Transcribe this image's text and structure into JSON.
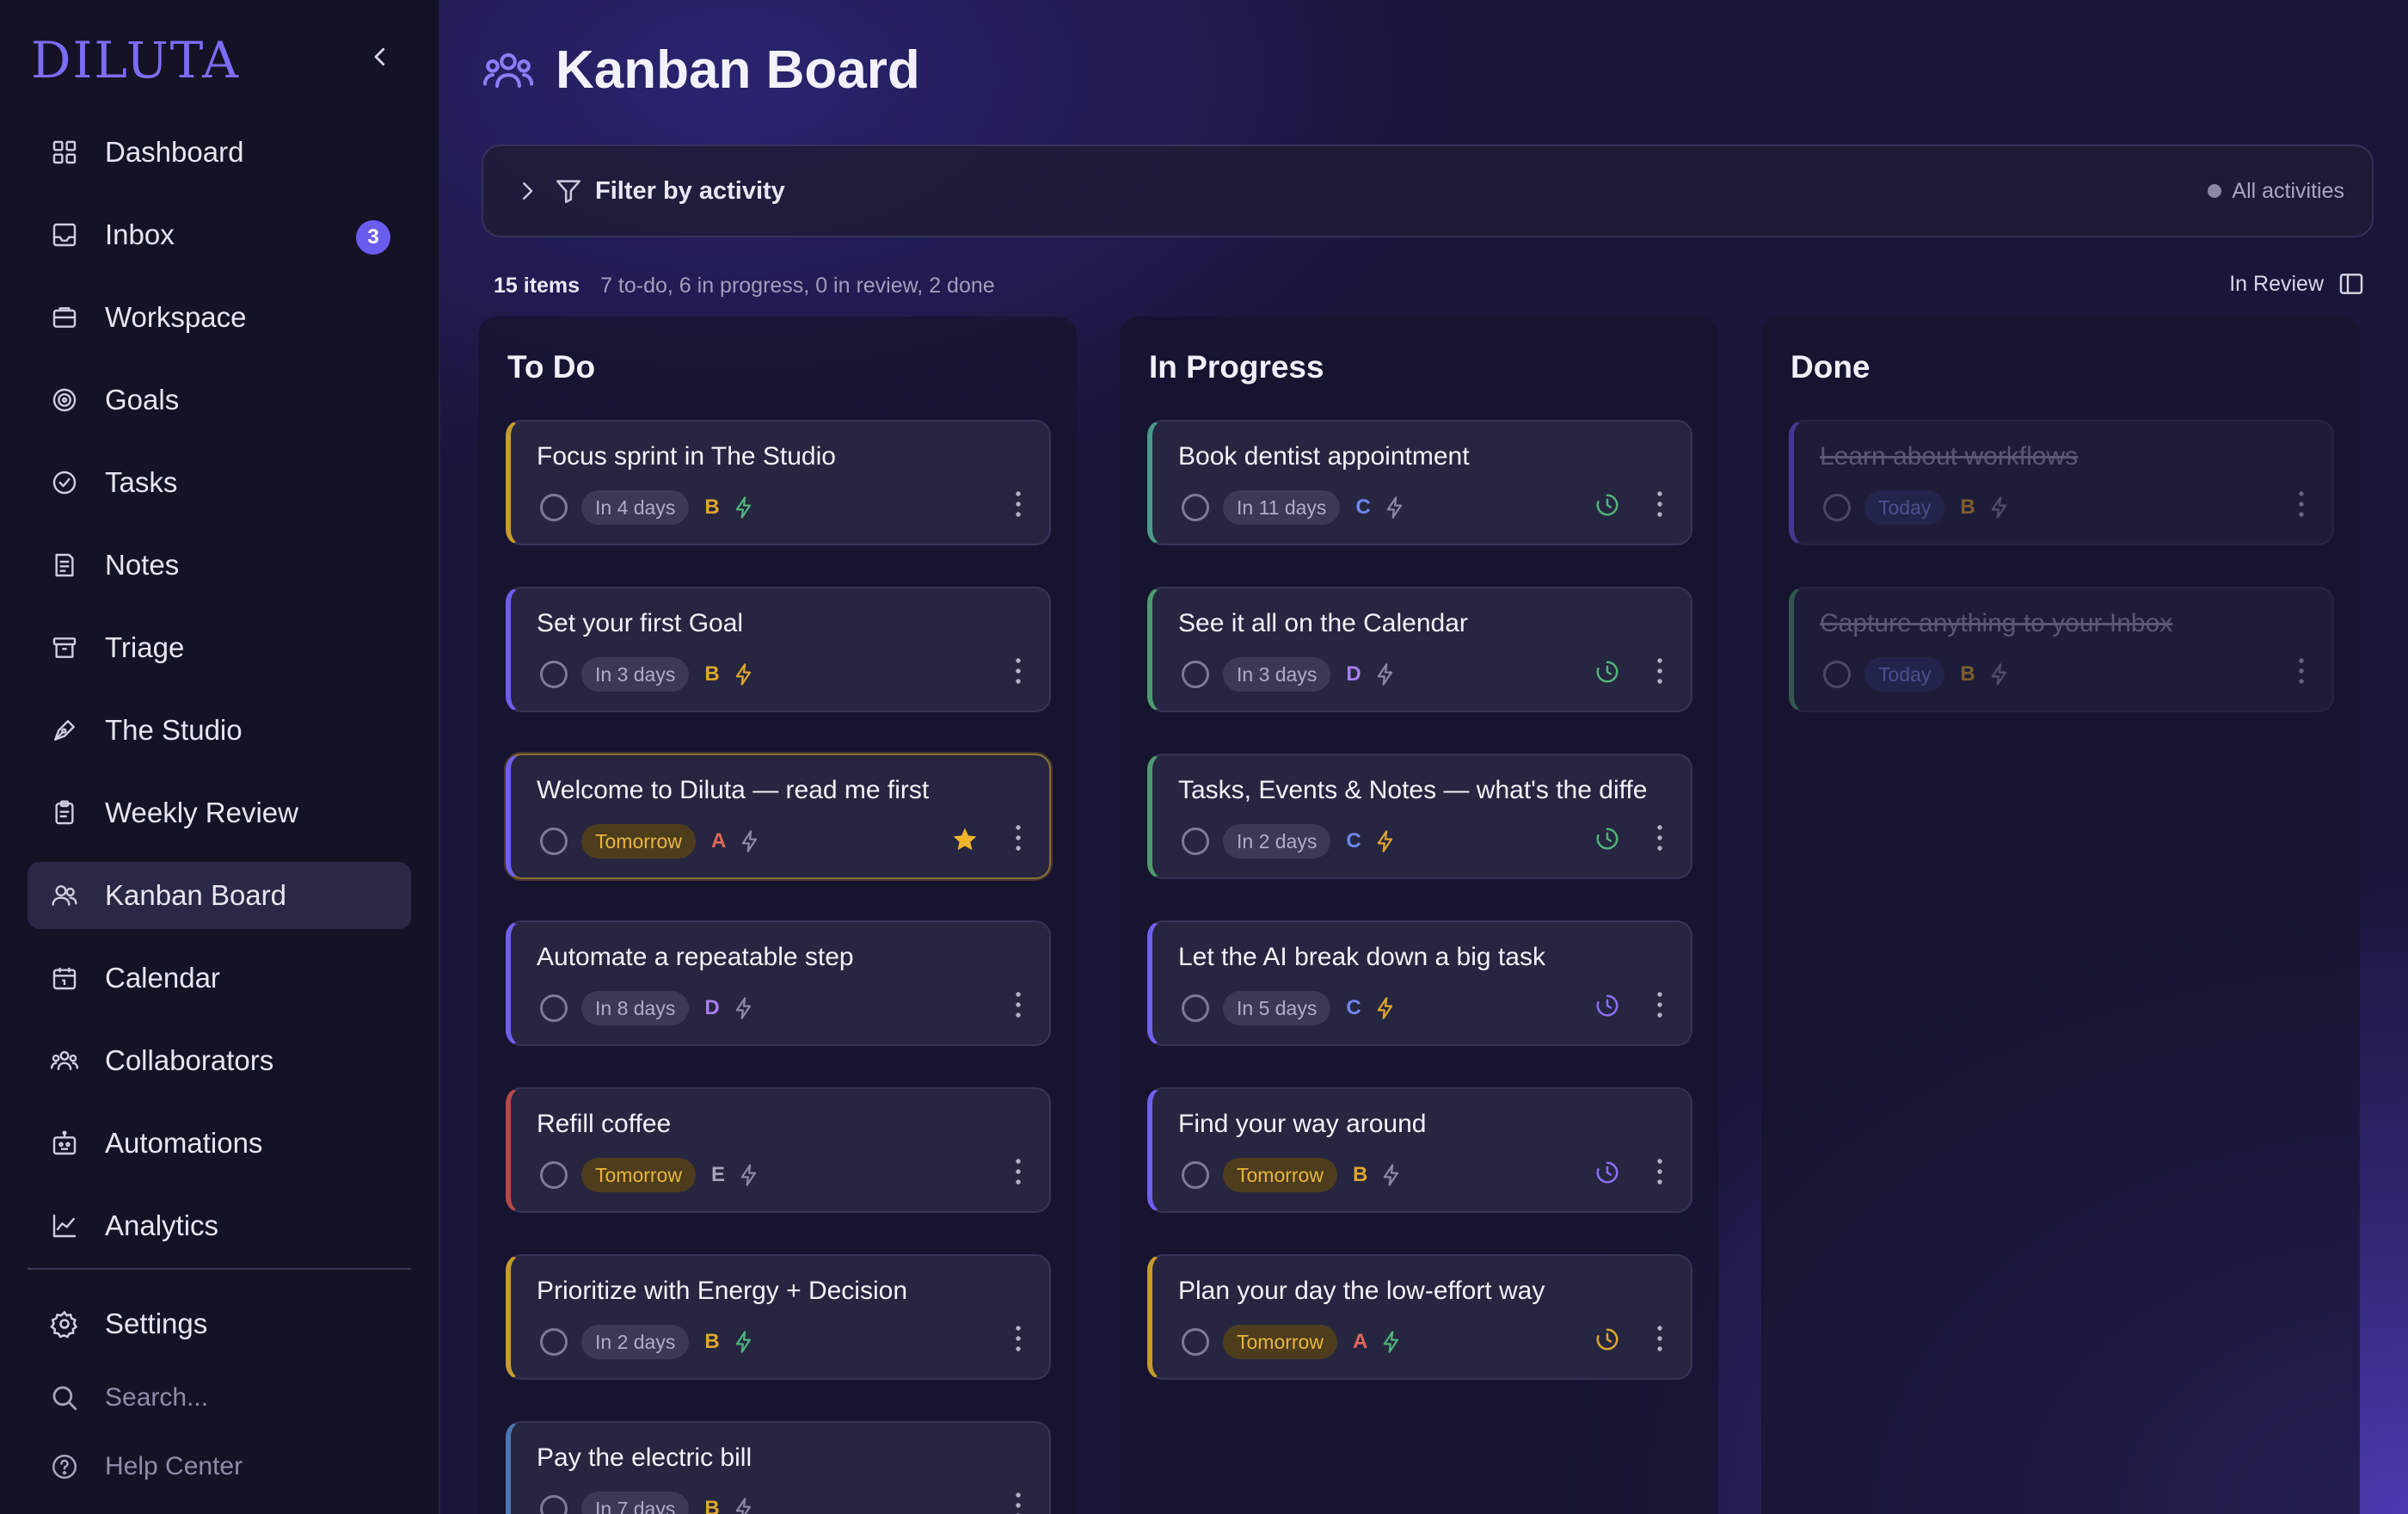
{
  "sidebar": {
    "logo": "DILUTA",
    "items": [
      {
        "label": "Dashboard",
        "icon": "grid-icon"
      },
      {
        "label": "Inbox",
        "icon": "inbox-icon",
        "badge": "3"
      },
      {
        "label": "Workspace",
        "icon": "briefcase-icon"
      },
      {
        "label": "Goals",
        "icon": "target-icon"
      },
      {
        "label": "Tasks",
        "icon": "check-circle-icon"
      },
      {
        "label": "Notes",
        "icon": "note-icon"
      },
      {
        "label": "Triage",
        "icon": "archive-icon"
      },
      {
        "label": "The Studio",
        "icon": "pen-icon"
      },
      {
        "label": "Weekly Review",
        "icon": "clipboard-icon"
      },
      {
        "label": "Kanban Board",
        "icon": "users-icon"
      },
      {
        "label": "Calendar",
        "icon": "calendar-icon"
      },
      {
        "label": "Collaborators",
        "icon": "team-icon"
      },
      {
        "label": "Automations",
        "icon": "robot-icon"
      },
      {
        "label": "Analytics",
        "icon": "chart-icon"
      }
    ],
    "settings": "Settings",
    "search_placeholder": "Search...",
    "help": "Help Center"
  },
  "header": {
    "title": "Kanban Board"
  },
  "filter": {
    "label": "Filter by activity",
    "right": "All activities"
  },
  "summary": {
    "count": "15 items",
    "detail": "7 to-do, 6 in progress, 0 in review, 2 done",
    "review_toggle": "In Review"
  },
  "colors": {
    "accent": "#6b5cf0",
    "yellow": "#c79b2c",
    "purple": "#6f5ff0",
    "green": "#4f9a6e",
    "teal": "#4a9a8a",
    "red": "#b74848",
    "blue": "#4a78b0"
  },
  "columns": [
    {
      "title": "To Do",
      "cards": [
        {
          "title": "Focus sprint in The Studio",
          "due": "In 4 days",
          "prio": "B"
        },
        {
          "title": "Set your first Goal",
          "due": "In 3 days",
          "prio": "B"
        },
        {
          "title": "Welcome to Diluta — read me first",
          "due": "Tomorrow",
          "prio": "A",
          "starred": true
        },
        {
          "title": "Automate a repeatable step",
          "due": "In 8 days",
          "prio": "D"
        },
        {
          "title": "Refill coffee",
          "due": "Tomorrow",
          "prio": "E"
        },
        {
          "title": "Prioritize with Energy + Decision",
          "due": "In 2 days",
          "prio": "B"
        },
        {
          "title": "Pay the electric bill",
          "due": "In 7 days",
          "prio": "B"
        }
      ]
    },
    {
      "title": "In Progress",
      "cards": [
        {
          "title": "Book dentist appointment",
          "due": "In 11 days",
          "prio": "C"
        },
        {
          "title": "See it all on the Calendar",
          "due": "In 3 days",
          "prio": "D"
        },
        {
          "title": "Tasks, Events & Notes — what's the diffe",
          "due": "In 2 days",
          "prio": "C"
        },
        {
          "title": "Let the AI break down a big task",
          "due": "In 5 days",
          "prio": "C"
        },
        {
          "title": "Find your way around",
          "due": "Tomorrow",
          "prio": "B"
        },
        {
          "title": "Plan your day the low-effort way",
          "due": "Tomorrow",
          "prio": "A"
        }
      ]
    },
    {
      "title": "Done",
      "cards": [
        {
          "title": "Learn about workflows",
          "due": "Today",
          "prio": "B"
        },
        {
          "title": "Capture anything to your Inbox",
          "due": "Today",
          "prio": "B"
        }
      ]
    }
  ]
}
